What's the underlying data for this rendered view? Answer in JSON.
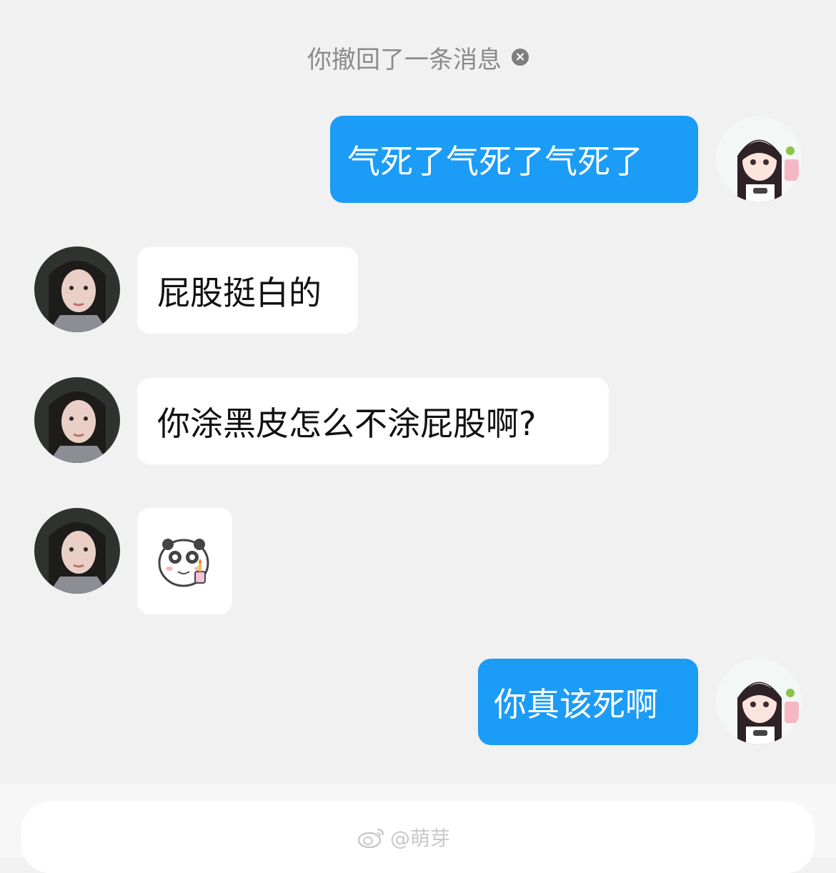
{
  "system": {
    "recall_notice": "你撤回了一条消息",
    "recall_close_glyph": "×"
  },
  "messages": [
    {
      "side": "out",
      "type": "text",
      "text": "气死了气死了气死了"
    },
    {
      "side": "in",
      "type": "text",
      "text": "屁股挺白的"
    },
    {
      "side": "in",
      "type": "text",
      "text": "你涂黑皮怎么不涂屁股啊?"
    },
    {
      "side": "in",
      "type": "sticker",
      "sticker_icon": "panda-sticker-icon"
    },
    {
      "side": "out",
      "type": "text",
      "text": "你真该死啊"
    }
  ],
  "watermark": {
    "text": "@萌芽",
    "icon": "weibo-logo-icon"
  },
  "colors": {
    "background": "#f1f1f1",
    "outgoing_bubble": "#1a9cf7",
    "incoming_bubble": "#ffffff"
  }
}
